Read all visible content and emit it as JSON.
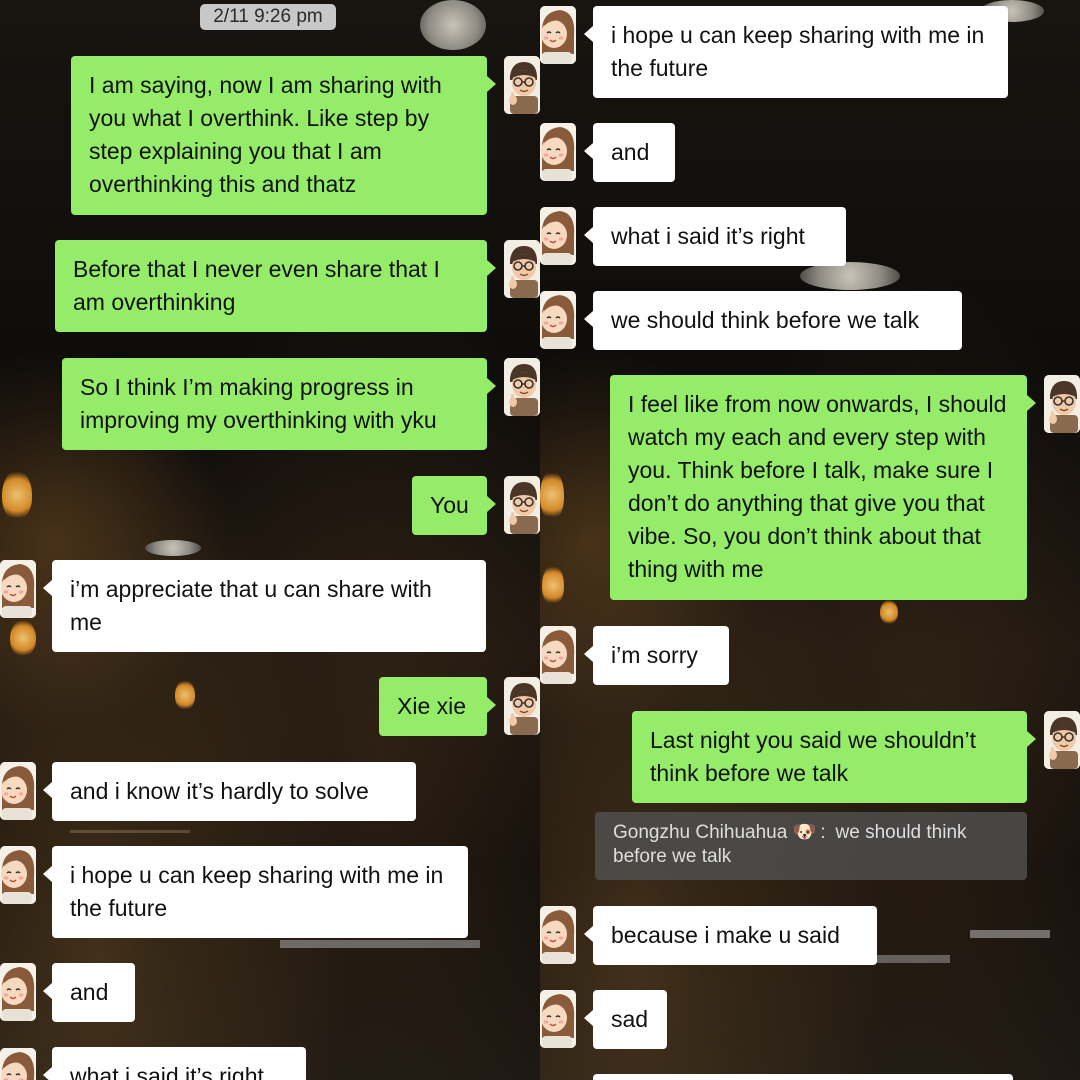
{
  "left_panel": {
    "timestamp": "2/11 9:26 pm",
    "messages": [
      {
        "side": "me",
        "text": "I am saying, now I am sharing with you what I overthink. Like step by step explaining you that I am overthinking this and thatz"
      },
      {
        "side": "me",
        "text": "Before that I never even share that I am overthinking"
      },
      {
        "side": "me",
        "text": "So I think I’m making progress in improving my overthinking with yku"
      },
      {
        "side": "me",
        "text": "You"
      },
      {
        "side": "them",
        "text": "i’m appreciate that u can share with me"
      },
      {
        "side": "me",
        "text": "Xie xie"
      },
      {
        "side": "them",
        "text": "and i know it’s hardly to solve"
      },
      {
        "side": "them",
        "text": "i hope u can keep sharing with me in the future"
      },
      {
        "side": "them",
        "text": "and"
      },
      {
        "side": "them",
        "text": "what i said it’s right"
      }
    ]
  },
  "right_panel": {
    "messages": [
      {
        "side": "them",
        "text": "i hope u can keep sharing with me in the future"
      },
      {
        "side": "them",
        "text": "and"
      },
      {
        "side": "them",
        "text": "what i said it’s right"
      },
      {
        "side": "them",
        "text": "we should think before we talk"
      },
      {
        "side": "me",
        "text": "I feel like from now onwards, I should watch my each and every step with you. Think before I talk, make sure I don’t do anything that give you that vibe. So, you don’t think about that thing with me"
      },
      {
        "side": "them",
        "text": "i’m sorry"
      },
      {
        "side": "me",
        "text": "Last night you said we shouldn’t think before we talk"
      },
      {
        "side": "them",
        "text": "because i make u said"
      },
      {
        "side": "them",
        "text": "sad"
      }
    ],
    "quote": {
      "sender": "Gongzhu Chihuahua",
      "sender_emoji": "🐶",
      "separator": ":",
      "text": "we should think before we talk"
    }
  },
  "avatars": {
    "me": "cartoon-boy-glasses-thumbs-up-avatar",
    "them": "cartoon-girl-avatar"
  },
  "colors": {
    "my_bubble": "#95ec69",
    "their_bubble": "#ffffff",
    "quote_bubble": "#505050",
    "timestamp_bg": "#c8c8c8"
  }
}
